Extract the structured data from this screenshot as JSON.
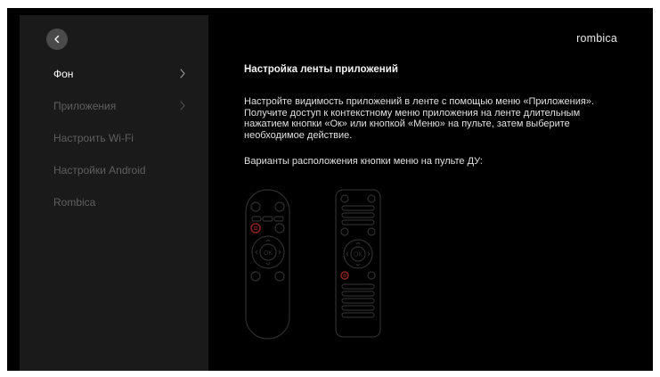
{
  "brand": {
    "logo_text": "rombica"
  },
  "sidebar": {
    "items": [
      {
        "label": "Фон",
        "active": true,
        "has_chevron": true
      },
      {
        "label": "Приложения",
        "active": false,
        "has_chevron": true
      },
      {
        "label": "Настроить Wi-Fi",
        "active": false,
        "has_chevron": false
      },
      {
        "label": "Настройки Android",
        "active": false,
        "has_chevron": false
      },
      {
        "label": "Rombica",
        "active": false,
        "has_chevron": false
      }
    ]
  },
  "main": {
    "title": "Настройка ленты приложений",
    "description": "Настройте видимость приложений в ленте с помощью меню «Приложения». Получите доступ к контекстному меню приложения на ленте длительным нажатием кнопки «Ок» или кнопкой «Меню» на пульте, затем выберите необходимое действие.",
    "remotes_caption": "Варианты расположения кнопки меню на пульте ДУ:",
    "remote_ok_label": "OK"
  },
  "colors": {
    "background": "#000000",
    "sidebar": "#1a1a1a",
    "highlight": "#8b2222",
    "outline": "#2e2e2e"
  }
}
